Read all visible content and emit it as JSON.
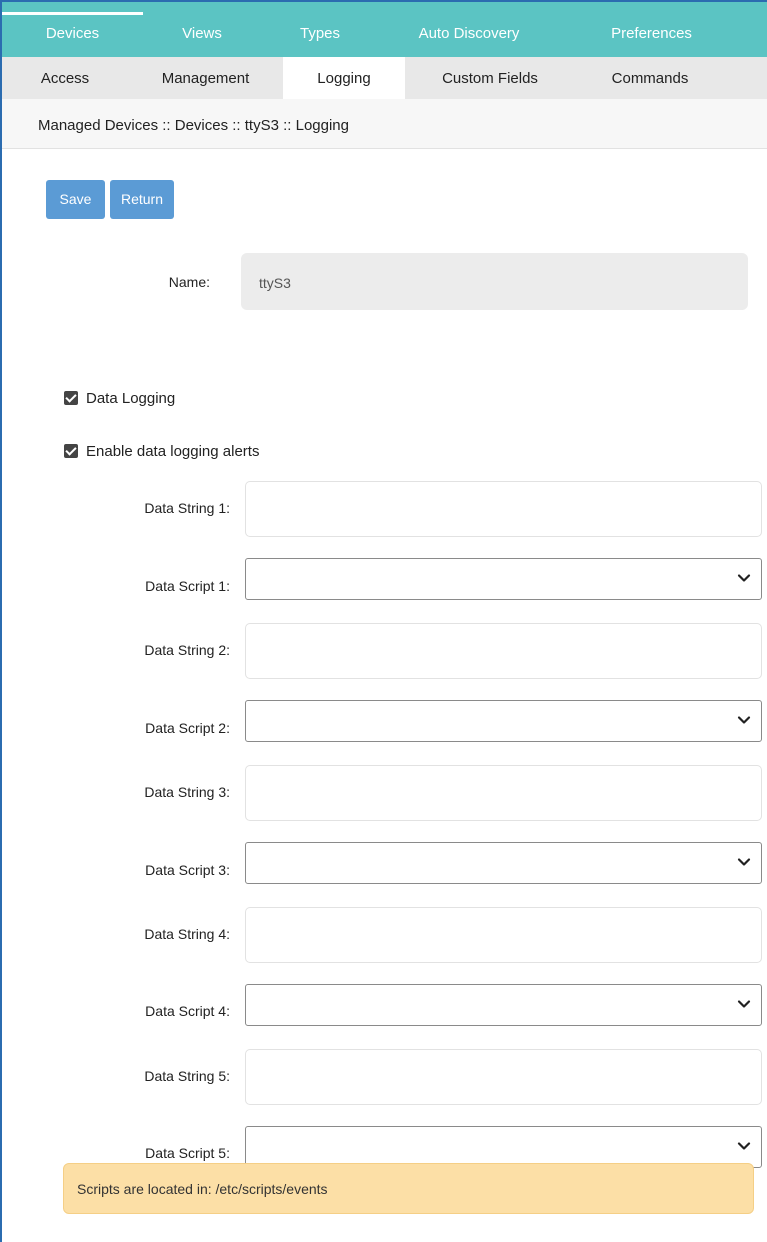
{
  "top_nav": {
    "tabs": [
      {
        "label": "Devices"
      },
      {
        "label": "Views"
      },
      {
        "label": "Types"
      },
      {
        "label": "Auto Discovery"
      },
      {
        "label": "Preferences"
      }
    ],
    "active": "Devices"
  },
  "sub_nav": {
    "tabs": [
      {
        "label": "Access"
      },
      {
        "label": "Management"
      },
      {
        "label": "Logging"
      },
      {
        "label": "Custom Fields"
      },
      {
        "label": "Commands"
      }
    ],
    "active": "Logging"
  },
  "breadcrumb": "Managed Devices :: Devices :: ttyS3 :: Logging",
  "toolbar": {
    "save_label": "Save",
    "return_label": "Return"
  },
  "form": {
    "name_label": "Name:",
    "name_value": "ttyS3",
    "data_logging_label": "Data Logging",
    "data_logging_checked": true,
    "alerts_label": "Enable data logging alerts",
    "alerts_checked": true,
    "strings": [
      {
        "label": "Data String 1:",
        "value": ""
      },
      {
        "label": "Data String 2:",
        "value": ""
      },
      {
        "label": "Data String 3:",
        "value": ""
      },
      {
        "label": "Data String 4:",
        "value": ""
      },
      {
        "label": "Data String 5:",
        "value": ""
      }
    ],
    "scripts": [
      {
        "label": "Data Script 1:",
        "value": ""
      },
      {
        "label": "Data Script 2:",
        "value": ""
      },
      {
        "label": "Data Script 3:",
        "value": ""
      },
      {
        "label": "Data Script 4:",
        "value": ""
      },
      {
        "label": "Data Script 5:",
        "value": ""
      }
    ]
  },
  "alert": {
    "text": "Scripts are located in: /etc/scripts/events"
  },
  "colors": {
    "nav_teal": "#5bc4c3",
    "button_blue": "#5b9bd5",
    "alert_bg": "#fcdfa6"
  }
}
